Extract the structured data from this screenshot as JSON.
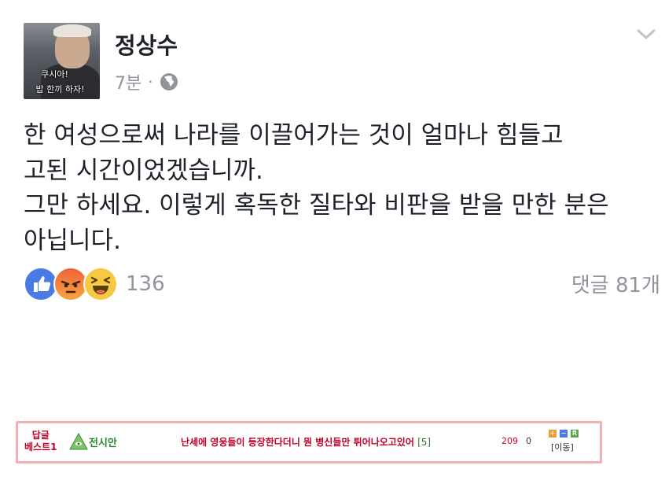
{
  "post": {
    "author": "정상수",
    "time": "7분",
    "separator": "·",
    "privacy_icon": "globe-icon",
    "avatar_caption_1": "쿠시아!",
    "avatar_caption_2": "밥 한끼 하자!",
    "body": "한 여성으로써 나라를 이끌어가는 것이 얼마나 힘들고\n고된 시간이었겠습니까.\n그만 하세요. 이렇게 혹독한 질타와 비판을 받을 만한 분은\n아닙니다.",
    "reaction_count": "136",
    "comment_count": "댓글 81개"
  },
  "banner": {
    "best_line1": "답글",
    "best_line2": "베스트1",
    "nickname": "전시안",
    "title": "난세에 영웅들이 등장한다더니 뭔 병신들만 튀어나오고있어",
    "reply_count": "[5]",
    "views": "209",
    "recommend": "0",
    "btn_plus": "+",
    "btn_minus": "−",
    "btn_r": "R",
    "move": "[이동]"
  },
  "colors": {
    "like": "#4a7be5",
    "angry": "#f0623a",
    "haha": "#f7c843",
    "meta_gray": "#90949c",
    "banner_border": "#f2b0b0",
    "banner_red": "#c4002a",
    "banner_green": "#2f8a2f"
  }
}
